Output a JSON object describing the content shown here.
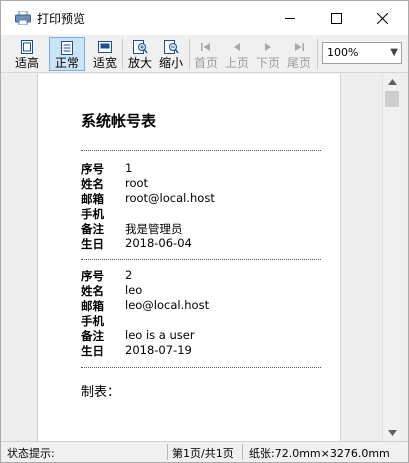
{
  "window": {
    "title": "打印预览"
  },
  "toolbar": {
    "buttons": [
      {
        "id": "fit-height",
        "label": "适高",
        "icon": "fit-height-icon",
        "enabled": true,
        "active": false
      },
      {
        "id": "normal",
        "label": "正常",
        "icon": "normal-page-icon",
        "enabled": true,
        "active": true
      },
      {
        "id": "fit-width",
        "label": "适宽",
        "icon": "fit-width-icon",
        "enabled": true,
        "active": false
      },
      {
        "id": "zoom-in",
        "label": "放大",
        "icon": "zoom-in-icon",
        "enabled": true,
        "active": false
      },
      {
        "id": "zoom-out",
        "label": "缩小",
        "icon": "zoom-out-icon",
        "enabled": true,
        "active": false
      },
      {
        "id": "first-page",
        "label": "首页",
        "icon": "first-page-icon",
        "enabled": false,
        "active": false
      },
      {
        "id": "prev-page",
        "label": "上页",
        "icon": "prev-page-icon",
        "enabled": false,
        "active": false
      },
      {
        "id": "next-page",
        "label": "下页",
        "icon": "next-page-icon",
        "enabled": false,
        "active": false
      },
      {
        "id": "last-page",
        "label": "尾页",
        "icon": "last-page-icon",
        "enabled": false,
        "active": false
      }
    ],
    "zoom": {
      "value": "100%"
    }
  },
  "document": {
    "title": "系统帐号表",
    "records": [
      {
        "fields": [
          {
            "label": "序号",
            "value": "1"
          },
          {
            "label": "姓名",
            "value": "root"
          },
          {
            "label": "邮箱",
            "value": "root@local.host"
          },
          {
            "label": "手机",
            "value": ""
          },
          {
            "label": "备注",
            "value": "我是管理员"
          },
          {
            "label": "生日",
            "value": "2018-06-04"
          }
        ]
      },
      {
        "fields": [
          {
            "label": "序号",
            "value": "2"
          },
          {
            "label": "姓名",
            "value": "leo"
          },
          {
            "label": "邮箱",
            "value": "leo@local.host"
          },
          {
            "label": "手机",
            "value": ""
          },
          {
            "label": "备注",
            "value": "leo is a user"
          },
          {
            "label": "生日",
            "value": "2018-07-19"
          }
        ]
      }
    ],
    "footer_label": "制表："
  },
  "status": {
    "hint": "状态提示:",
    "page": "第1页/共1页",
    "paper": "纸张:72.0mm×3276.0mm"
  },
  "colors": {
    "active_button_bg": "#cce4f7",
    "icon_blue": "#1f5fa8"
  }
}
